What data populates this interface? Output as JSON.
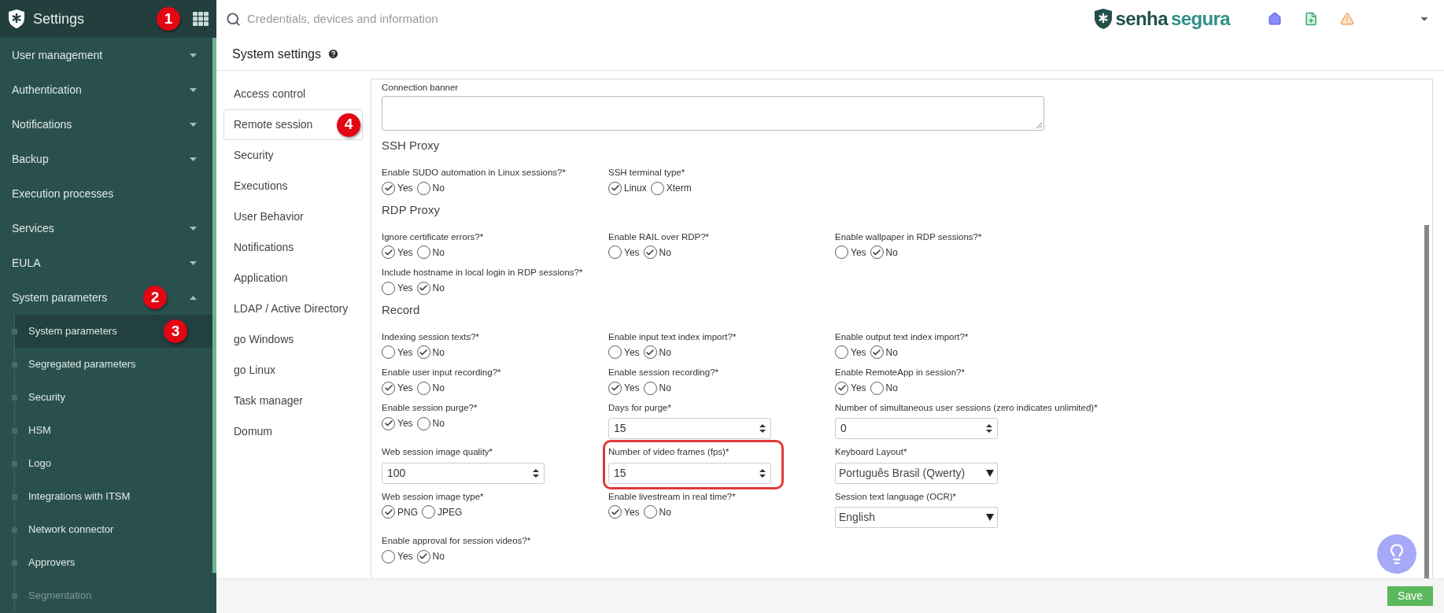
{
  "sidebar": {
    "title": "Settings",
    "badge": "1",
    "items": [
      {
        "kind": "group",
        "label": "User management",
        "expanded": false
      },
      {
        "kind": "group",
        "label": "Authentication",
        "expanded": false
      },
      {
        "kind": "group",
        "label": "Notifications",
        "expanded": false
      },
      {
        "kind": "group",
        "label": "Backup",
        "expanded": false
      },
      {
        "kind": "link",
        "label": "Execution processes"
      },
      {
        "kind": "group",
        "label": "Services",
        "expanded": false
      },
      {
        "kind": "group",
        "label": "EULA",
        "expanded": false
      },
      {
        "kind": "group",
        "label": "System parameters",
        "expanded": true,
        "badge": "2",
        "children": [
          {
            "label": "System parameters",
            "selected": true,
            "disabled": false,
            "badge": "3"
          },
          {
            "label": "Segregated parameters",
            "selected": false,
            "disabled": false
          },
          {
            "label": "Security",
            "selected": false,
            "disabled": false
          },
          {
            "label": "HSM",
            "selected": false,
            "disabled": false
          },
          {
            "label": "Logo",
            "selected": false,
            "disabled": false
          },
          {
            "label": "Integrations with ITSM",
            "selected": false,
            "disabled": false
          },
          {
            "label": "Network connector",
            "selected": false,
            "disabled": false
          },
          {
            "label": "Approvers",
            "selected": false,
            "disabled": false
          },
          {
            "label": "Segmentation",
            "selected": false,
            "disabled": true
          }
        ]
      }
    ]
  },
  "search": {
    "placeholder": "Credentials, devices and information"
  },
  "logo": {
    "part_1": "senha",
    "part_2": "segura"
  },
  "page_title": "System settings",
  "tabs": [
    {
      "label": "Access control",
      "selected": false
    },
    {
      "label": "Remote session",
      "selected": true,
      "badge": "4"
    },
    {
      "label": "Security",
      "selected": false
    },
    {
      "label": "Executions",
      "selected": false
    },
    {
      "label": "User Behavior",
      "selected": false
    },
    {
      "label": "Notifications",
      "selected": false
    },
    {
      "label": "Application",
      "selected": false
    },
    {
      "label": "LDAP / Active Directory",
      "selected": false
    },
    {
      "label": "go Windows",
      "selected": false
    },
    {
      "label": "go Linux",
      "selected": false
    },
    {
      "label": "Task manager",
      "selected": false
    },
    {
      "label": "Domum",
      "selected": false
    }
  ],
  "sections": [
    {
      "fields": [
        {
          "kind": "textarea",
          "label": "Connection banner"
        }
      ]
    },
    {
      "title": "SSH Proxy",
      "fields": [
        {
          "kind": "radio",
          "label": "Enable SUDO automation in Linux sessions?*",
          "options": [
            {
              "label": "Yes",
              "checked": true
            },
            {
              "label": "No",
              "checked": false
            }
          ]
        },
        {
          "kind": "radio",
          "label": "SSH terminal type*",
          "options": [
            {
              "label": "Linux",
              "checked": true
            },
            {
              "label": "Xterm",
              "checked": false
            }
          ]
        }
      ]
    },
    {
      "title": "RDP Proxy",
      "fields": [
        {
          "kind": "radio",
          "label": "Ignore certificate errors?*",
          "options": [
            {
              "label": "Yes",
              "checked": true
            },
            {
              "label": "No",
              "checked": false
            }
          ]
        },
        {
          "kind": "radio",
          "label": "Enable RAIL over RDP?*",
          "options": [
            {
              "label": "Yes",
              "checked": false
            },
            {
              "label": "No",
              "checked": true
            }
          ]
        },
        {
          "kind": "radio",
          "label": "Enable wallpaper in RDP sessions?*",
          "options": [
            {
              "label": "Yes",
              "checked": false
            },
            {
              "label": "No",
              "checked": true
            }
          ]
        },
        {
          "kind": "radio",
          "label": "Include hostname in local login in RDP sessions?*",
          "options": [
            {
              "label": "Yes",
              "checked": false
            },
            {
              "label": "No",
              "checked": true
            }
          ]
        }
      ]
    },
    {
      "title": "Record",
      "fields": [
        {
          "kind": "radio",
          "label": "Indexing session texts?*",
          "options": [
            {
              "label": "Yes",
              "checked": false
            },
            {
              "label": "No",
              "checked": true
            }
          ]
        },
        {
          "kind": "radio",
          "label": "Enable input text index import?*",
          "options": [
            {
              "label": "Yes",
              "checked": false
            },
            {
              "label": "No",
              "checked": true
            }
          ]
        },
        {
          "kind": "radio",
          "label": "Enable output text index import?*",
          "options": [
            {
              "label": "Yes",
              "checked": false
            },
            {
              "label": "No",
              "checked": true
            }
          ]
        },
        {
          "kind": "radio",
          "label": "Enable user input recording?*",
          "options": [
            {
              "label": "Yes",
              "checked": true
            },
            {
              "label": "No",
              "checked": false
            }
          ]
        },
        {
          "kind": "radio",
          "label": "Enable session recording?*",
          "options": [
            {
              "label": "Yes",
              "checked": true
            },
            {
              "label": "No",
              "checked": false
            }
          ]
        },
        {
          "kind": "radio",
          "label": "Enable RemoteApp in session?*",
          "options": [
            {
              "label": "Yes",
              "checked": true
            },
            {
              "label": "No",
              "checked": false
            }
          ]
        },
        {
          "kind": "radio",
          "label": "Enable session purge?*",
          "options": [
            {
              "label": "Yes",
              "checked": true
            },
            {
              "label": "No",
              "checked": false
            }
          ]
        },
        {
          "kind": "number",
          "label": "Days for purge*",
          "value": "15"
        },
        {
          "kind": "number",
          "label": "Number of simultaneous user sessions (zero indicates unlimited)*",
          "value": "0"
        },
        {
          "kind": "number",
          "label": "Web session image quality*",
          "value": "100"
        },
        {
          "kind": "number",
          "label": "Number of video frames (fps)*",
          "value": "15",
          "highlighted": true
        },
        {
          "kind": "select",
          "label": "Keyboard Layout*",
          "value": "Português Brasil (Qwerty)"
        },
        {
          "kind": "radio",
          "label": "Web session image type*",
          "options": [
            {
              "label": "PNG",
              "checked": true
            },
            {
              "label": "JPEG",
              "checked": false
            }
          ]
        },
        {
          "kind": "radio",
          "label": "Enable livestream in real time?*",
          "options": [
            {
              "label": "Yes",
              "checked": true
            },
            {
              "label": "No",
              "checked": false
            }
          ]
        },
        {
          "kind": "select",
          "label": "Session text language (OCR)*",
          "value": "English"
        },
        {
          "kind": "radio",
          "label": "Enable approval for session videos?*",
          "options": [
            {
              "label": "Yes",
              "checked": false
            },
            {
              "label": "No",
              "checked": true
            }
          ]
        }
      ]
    }
  ],
  "save_button": "Save"
}
